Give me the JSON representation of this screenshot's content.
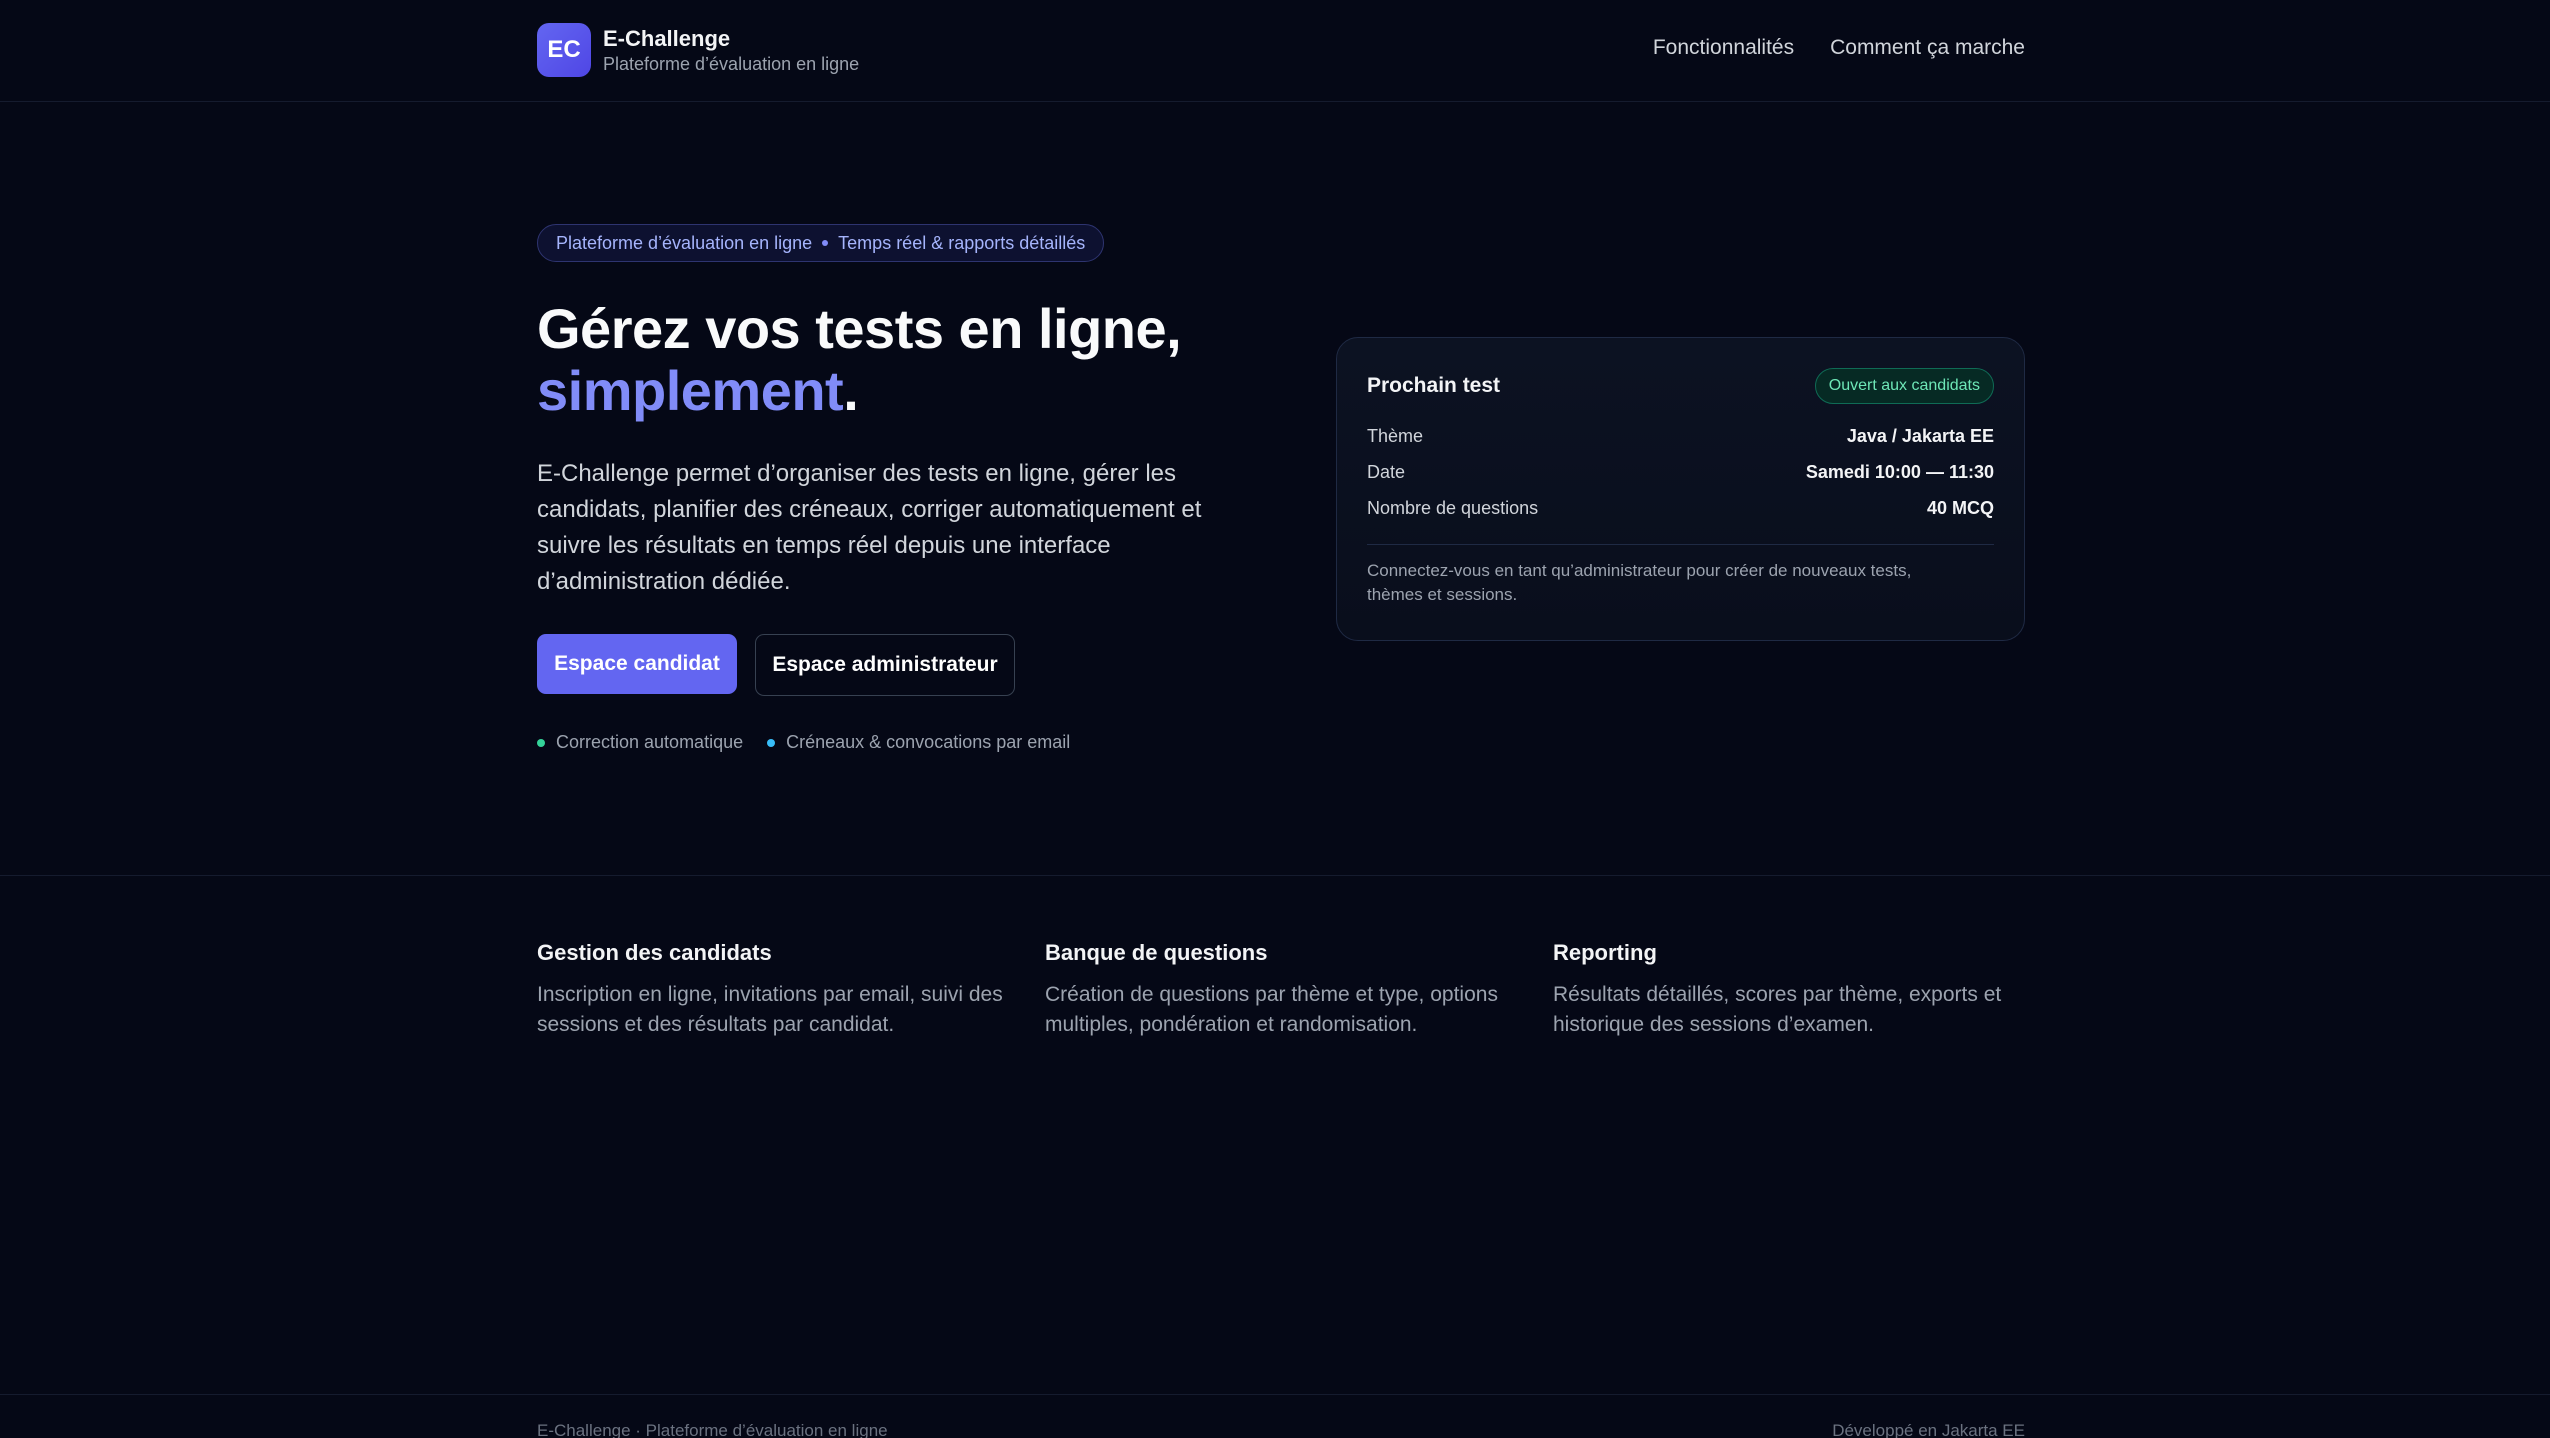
{
  "header": {
    "logo_text": "EC",
    "brand_name": "E-Challenge",
    "brand_tagline": "Plateforme d’évaluation en ligne",
    "nav": [
      {
        "label": "Fonctionnalités"
      },
      {
        "label": "Comment ça marche"
      }
    ]
  },
  "hero": {
    "pill_left": "Plateforme d’évaluation en ligne",
    "pill_right": "Temps réel & rapports détaillés",
    "title_line1": "Gérez vos tests en ligne,",
    "title_accent": "simplement",
    "title_period": ".",
    "description": "E-Challenge permet d’organiser des tests en ligne, gérer les candidats, planifier des créneaux, corriger automatiquement et suivre les résultats en temps réel depuis une interface d’administration dédiée.",
    "btn_candidate": "Espace candidat",
    "btn_admin": "Espace administrateur",
    "bullets": [
      {
        "label": "Correction automatique",
        "color": "#34d399"
      },
      {
        "label": "Créneaux & convocations par email",
        "color": "#38bdf8"
      }
    ]
  },
  "card": {
    "title": "Prochain test",
    "badge": "Ouvert aux candidats",
    "rows": [
      {
        "key": "Thème",
        "value": "Java / Jakarta EE"
      },
      {
        "key": "Date",
        "value": "Samedi 10:00 — 11:30"
      },
      {
        "key": "Nombre de questions",
        "value": "40 MCQ"
      }
    ],
    "note": "Connectez-vous en tant qu’administrateur pour créer de nouveaux tests, thèmes et sessions."
  },
  "features": [
    {
      "title": "Gestion des candidats",
      "text": "Inscription en ligne, invitations par email, suivi des sessions et des résultats par candidat."
    },
    {
      "title": "Banque de questions",
      "text": "Création de questions par thème et type, options multiples, pondération et randomisation."
    },
    {
      "title": "Reporting",
      "text": "Résultats détaillés, scores par thème, exports et historique des sessions d’examen."
    }
  ],
  "footer": {
    "left": "E-Challenge · Plateforme d’évaluation en ligne",
    "right": "Développé en Jakarta EE"
  },
  "colors": {
    "background": "#050816",
    "accent": "#6366f1",
    "accent_text": "#818cf8",
    "success": "#6ee7b7"
  }
}
